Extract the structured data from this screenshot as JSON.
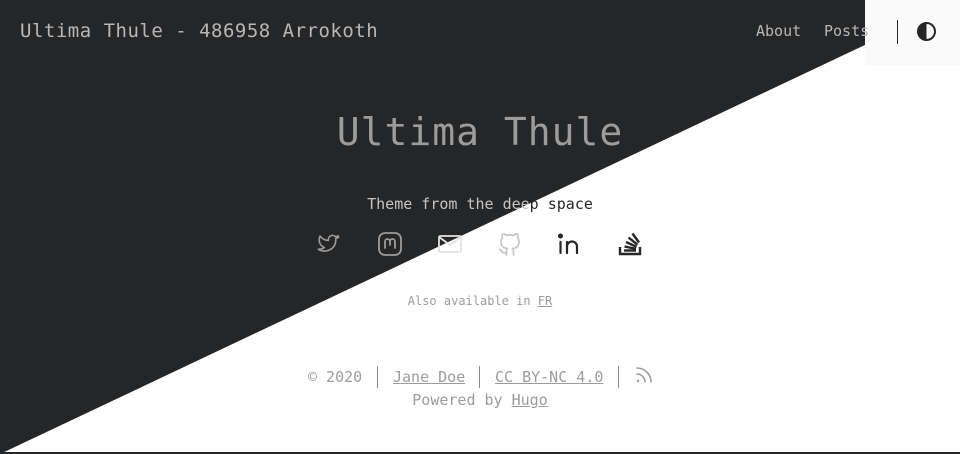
{
  "header": {
    "site_title": "Ultima Thule - 486958 Arrokoth",
    "nav": [
      {
        "label": "About"
      },
      {
        "label": "Posts"
      }
    ],
    "theme_toggle_icon": "contrast-icon"
  },
  "hero": {
    "title": "Ultima Thule",
    "tagline_light": "Theme from the dee",
    "tagline_dark": "p space"
  },
  "social_links": [
    {
      "icon": "twitter-icon"
    },
    {
      "icon": "mastodon-icon"
    },
    {
      "icon": "email-icon"
    },
    {
      "icon": "github-icon"
    },
    {
      "icon": "linkedin-icon"
    },
    {
      "icon": "stackoverflow-icon"
    }
  ],
  "language": {
    "prefix": "Also available in ",
    "link": "FR"
  },
  "footer": {
    "copyright": "© 2020",
    "author": "Jane Doe",
    "license": "CC BY-NC 4.0",
    "rss_icon": "rss-icon",
    "powered_prefix": "Powered by ",
    "powered_link": "Hugo"
  },
  "colors": {
    "dark_background": "#252628",
    "light_background": "#ffffff",
    "muted_text": "#9c9c9c",
    "light_text": "#b7b7b7"
  }
}
